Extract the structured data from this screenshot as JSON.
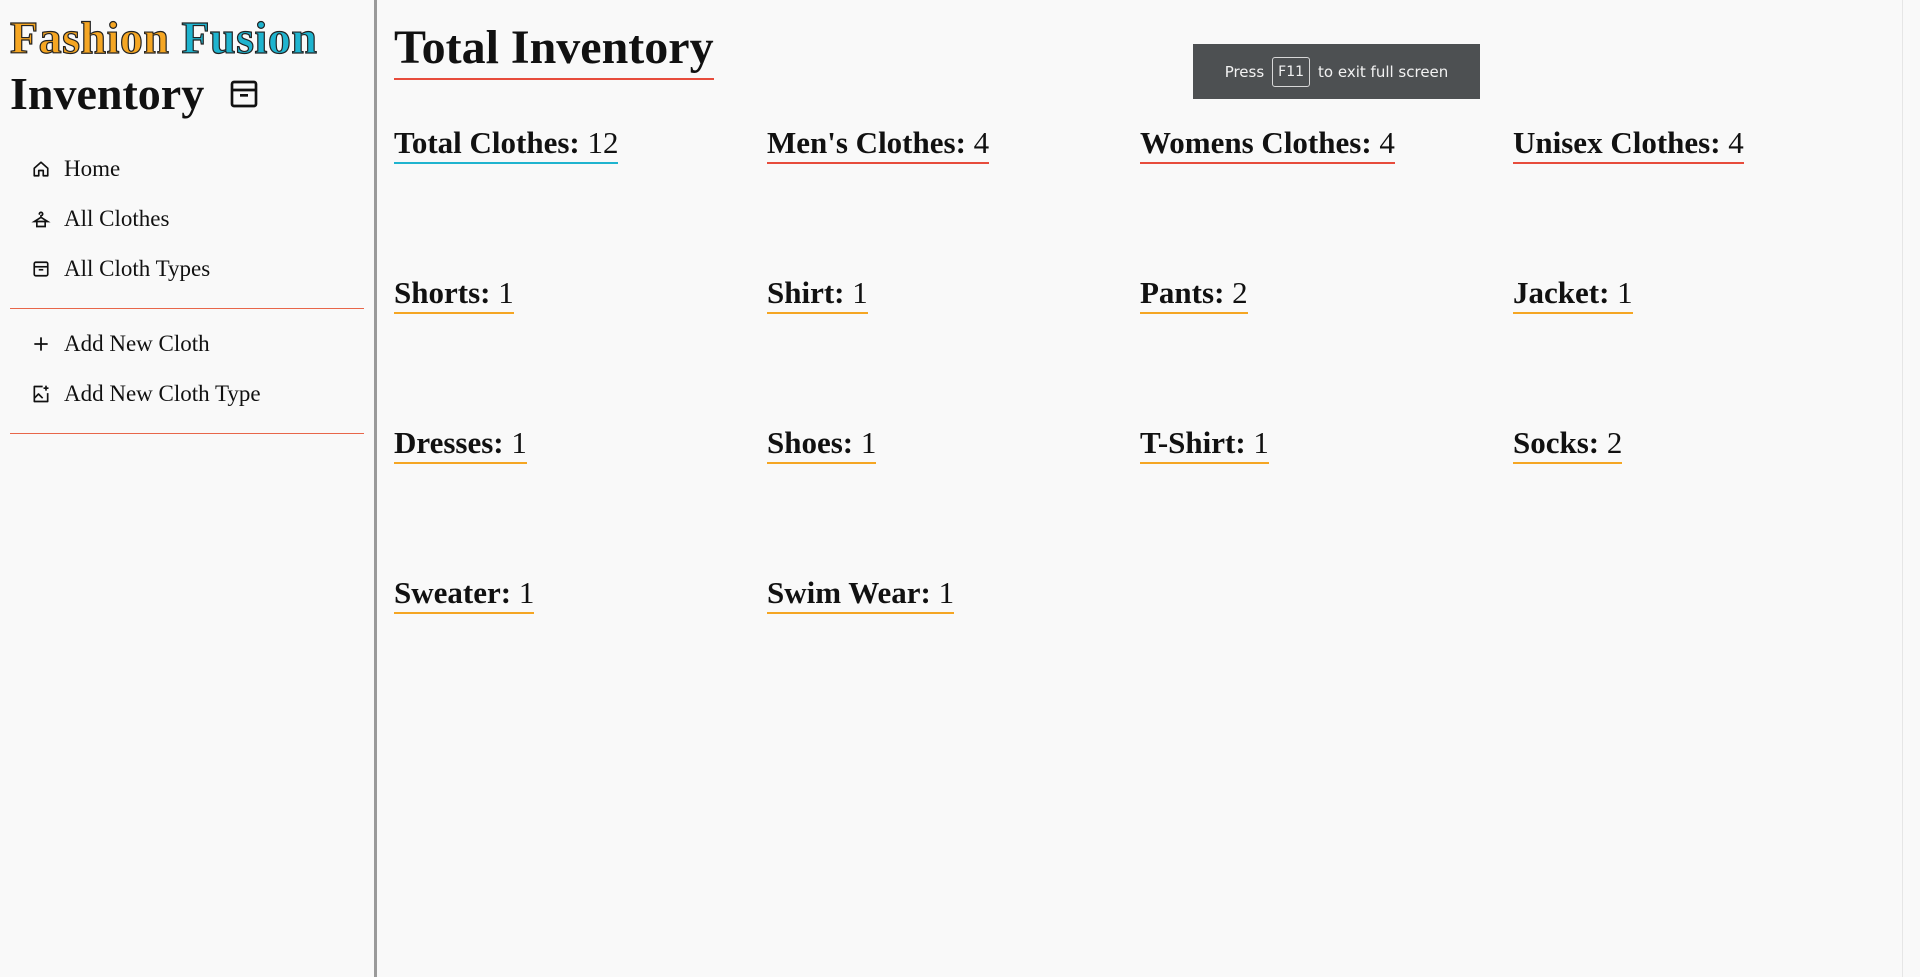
{
  "sidebar": {
    "brand_word1": "Fashion",
    "brand_word2": "Fusion",
    "subtitle": "Inventory",
    "subtitle_icon": "archive-icon",
    "nav_primary": [
      {
        "label": "Home",
        "icon": "home-icon"
      },
      {
        "label": "All Clothes",
        "icon": "hanger-icon"
      },
      {
        "label": "All Cloth Types",
        "icon": "archive-icon"
      }
    ],
    "nav_secondary": [
      {
        "label": "Add New Cloth",
        "icon": "plus-icon"
      },
      {
        "label": "Add New Cloth Type",
        "icon": "add-image-icon"
      }
    ]
  },
  "main": {
    "title": "Total Inventory",
    "stats": [
      {
        "label": "Total Clothes:",
        "value": "12"
      },
      {
        "label": "Men's Clothes:",
        "value": "4"
      },
      {
        "label": "Womens Clothes:",
        "value": "4"
      },
      {
        "label": "Unisex Clothes:",
        "value": "4"
      },
      {
        "label": "Shorts:",
        "value": "1"
      },
      {
        "label": "Shirt:",
        "value": "1"
      },
      {
        "label": "Pants:",
        "value": "2"
      },
      {
        "label": "Jacket:",
        "value": "1"
      },
      {
        "label": "Dresses:",
        "value": "1"
      },
      {
        "label": "Shoes:",
        "value": "1"
      },
      {
        "label": "T-Shirt:",
        "value": "1"
      },
      {
        "label": "Socks:",
        "value": "2"
      },
      {
        "label": "Sweater:",
        "value": "1"
      },
      {
        "label": "Swim Wear:",
        "value": "1"
      }
    ]
  },
  "toast": {
    "before": "Press",
    "key": "F11",
    "after": "to exit full screen"
  },
  "colors": {
    "brand_orange": "#f5a623",
    "brand_teal": "#1fb4cf",
    "accent_red": "#e74c3c"
  }
}
